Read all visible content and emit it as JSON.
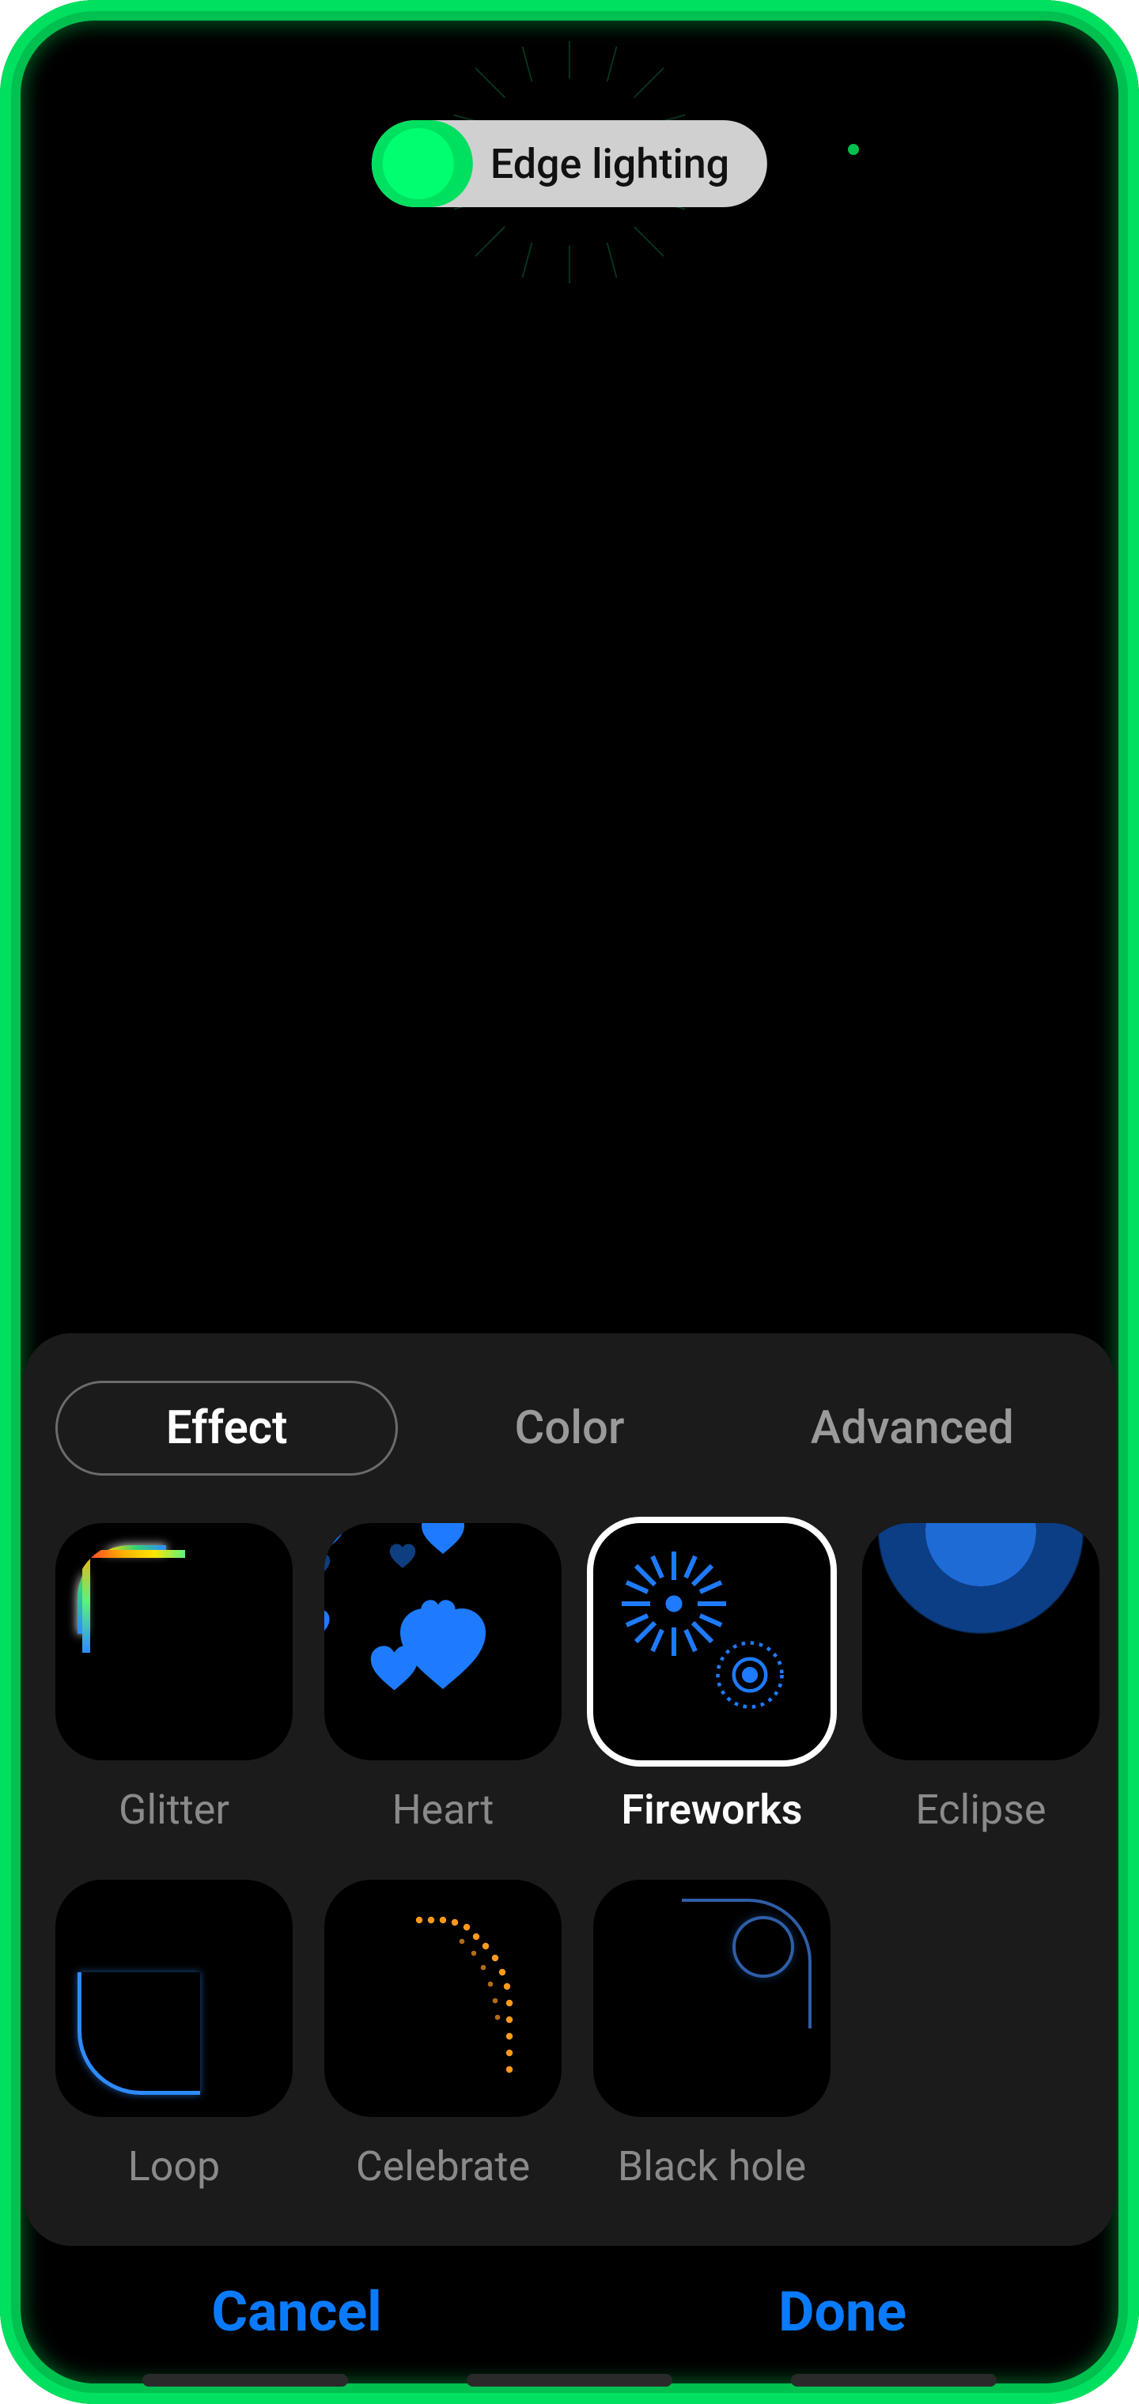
{
  "colors": {
    "edge_glow": "#00e060",
    "accent_blue": "#0a7bff",
    "panel_bg": "#1b1b1b"
  },
  "toggle": {
    "label": "Edge lighting",
    "on": true
  },
  "tabs": [
    {
      "id": "effect",
      "label": "Effect",
      "active": true
    },
    {
      "id": "color",
      "label": "Color",
      "active": false
    },
    {
      "id": "advanced",
      "label": "Advanced",
      "active": false
    }
  ],
  "effects": [
    {
      "id": "glitter",
      "label": "Glitter",
      "selected": false
    },
    {
      "id": "heart",
      "label": "Heart",
      "selected": false
    },
    {
      "id": "fireworks",
      "label": "Fireworks",
      "selected": true
    },
    {
      "id": "eclipse",
      "label": "Eclipse",
      "selected": false
    },
    {
      "id": "loop",
      "label": "Loop",
      "selected": false
    },
    {
      "id": "celebrate",
      "label": "Celebrate",
      "selected": false
    },
    {
      "id": "blackhole",
      "label": "Black hole",
      "selected": false
    }
  ],
  "footer": {
    "cancel": "Cancel",
    "done": "Done"
  }
}
